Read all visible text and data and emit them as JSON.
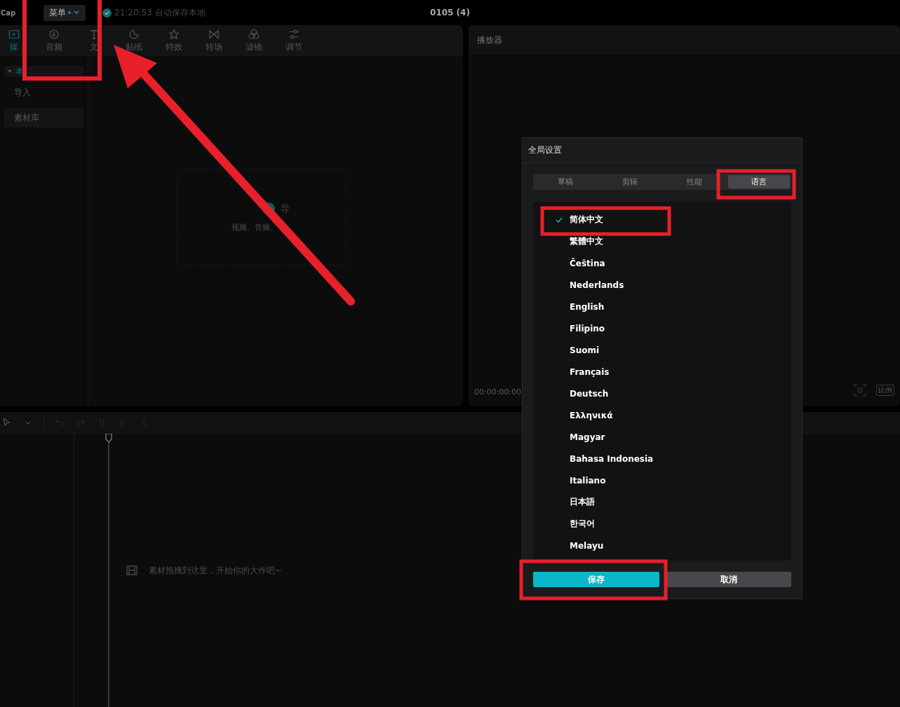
{
  "top_bar": {
    "logo": "Cap",
    "menu": {
      "label": "菜单",
      "notify": true
    },
    "save_status": "21:20:53 自动保存本地",
    "project_title": "0105 (4)"
  },
  "toolbar_tabs": [
    {
      "label": "媒",
      "selected": true
    },
    {
      "label": "音频",
      "selected": false
    },
    {
      "label": "文",
      "selected": false
    },
    {
      "label": "贴纸",
      "selected": false
    },
    {
      "label": "特效",
      "selected": false
    },
    {
      "label": "转场",
      "selected": false
    },
    {
      "label": "滤镜",
      "selected": false
    },
    {
      "label": "调节",
      "selected": false
    }
  ],
  "sidebar": {
    "items": [
      {
        "label": "本",
        "selected": true,
        "expanded": true
      },
      {
        "label": "导入",
        "selected": false
      },
      {
        "label": "素材库",
        "selected": false
      }
    ]
  },
  "import_card": {
    "title": "导",
    "hint": "视频、音频、"
  },
  "player": {
    "title": "播放器",
    "timecode": "00:00:00:00",
    "ratio_button": "比例"
  },
  "timeline": {
    "tools": [
      {
        "disabled": false
      },
      {
        "disabled": false
      },
      {
        "disabled": true
      },
      {
        "disabled": true
      },
      {
        "disabled": true
      },
      {
        "disabled": true
      },
      {
        "disabled": true
      }
    ],
    "empty_hint": "素材拖拽到这里，开始你的大作吧~"
  },
  "dialog": {
    "title": "全局设置",
    "tabs": [
      {
        "label": "草稿",
        "selected": false
      },
      {
        "label": "剪辑",
        "selected": false
      },
      {
        "label": "性能",
        "selected": false
      },
      {
        "label": "语言",
        "selected": true
      }
    ],
    "languages": [
      {
        "label": "简体中文",
        "selected": true
      },
      {
        "label": "繁體中文",
        "selected": false
      },
      {
        "label": "Čeština",
        "selected": false
      },
      {
        "label": "Nederlands",
        "selected": false
      },
      {
        "label": "English",
        "selected": false
      },
      {
        "label": "Filipino",
        "selected": false
      },
      {
        "label": "Suomi",
        "selected": false
      },
      {
        "label": "Français",
        "selected": false
      },
      {
        "label": "Deutsch",
        "selected": false
      },
      {
        "label": "Ελληνικά",
        "selected": false
      },
      {
        "label": "Magyar",
        "selected": false
      },
      {
        "label": "Bahasa Indonesia",
        "selected": false
      },
      {
        "label": "Italiano",
        "selected": false
      },
      {
        "label": "日本語",
        "selected": false
      },
      {
        "label": "한국어",
        "selected": false
      },
      {
        "label": "Melayu",
        "selected": false
      }
    ],
    "buttons": [
      {
        "label": "保存",
        "kind": "primary"
      },
      {
        "label": "取消",
        "kind": "secondary"
      }
    ]
  }
}
